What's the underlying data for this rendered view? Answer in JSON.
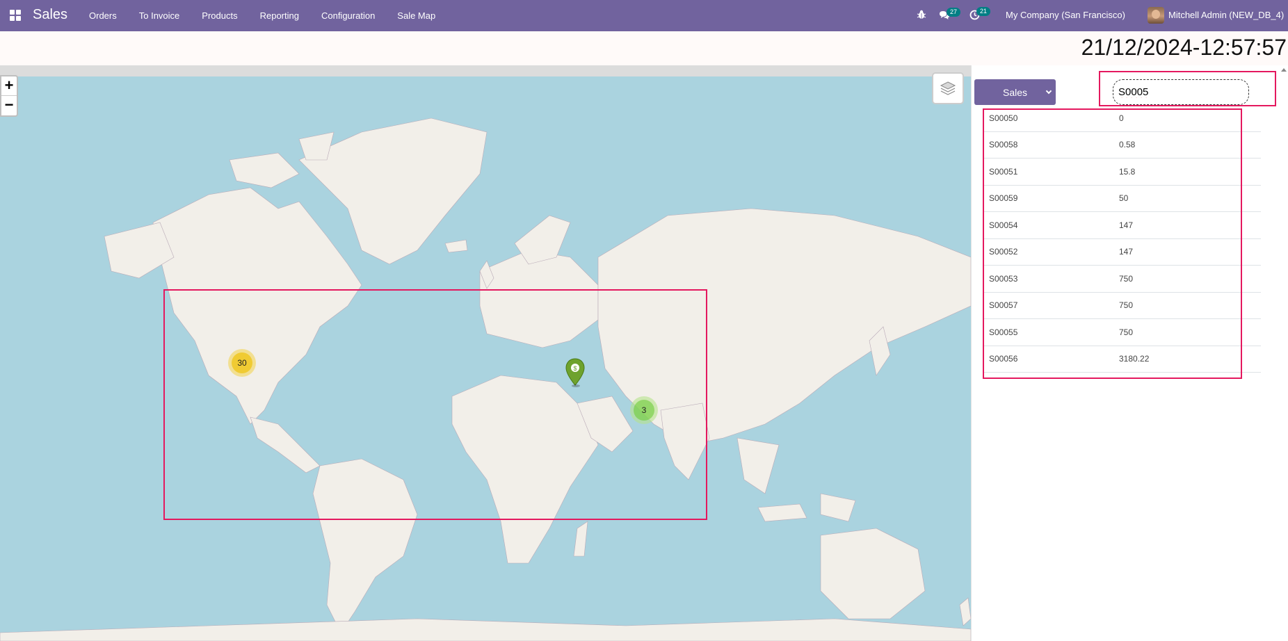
{
  "navbar": {
    "brand": "Sales",
    "menu": [
      "Orders",
      "To Invoice",
      "Products",
      "Reporting",
      "Configuration",
      "Sale Map"
    ],
    "messages_count": "27",
    "activities_count": "21",
    "company": "My Company (San Francisco)",
    "user": "Mitchell Admin (NEW_DB_4)",
    "color": "#71639e"
  },
  "clock": "21/12/2024-12:57:57",
  "map": {
    "zoom_in": "+",
    "zoom_out": "−",
    "clusters": [
      {
        "count": "30",
        "color": "yellow"
      },
      {
        "count": "3",
        "color": "green"
      }
    ],
    "pin_label": "$"
  },
  "panel": {
    "select_value": "Sales",
    "search_value": "S0005",
    "results": [
      {
        "ref": "S00050",
        "amount": "0"
      },
      {
        "ref": "S00058",
        "amount": "0.58"
      },
      {
        "ref": "S00051",
        "amount": "15.8"
      },
      {
        "ref": "S00059",
        "amount": "50"
      },
      {
        "ref": "S00054",
        "amount": "147"
      },
      {
        "ref": "S00052",
        "amount": "147"
      },
      {
        "ref": "S00053",
        "amount": "750"
      },
      {
        "ref": "S00057",
        "amount": "750"
      },
      {
        "ref": "S00055",
        "amount": "750"
      },
      {
        "ref": "S00056",
        "amount": "3180.22"
      }
    ]
  },
  "colors": {
    "highlight": "#e4185e",
    "water": "#aad3df",
    "land": "#f2efe9"
  }
}
